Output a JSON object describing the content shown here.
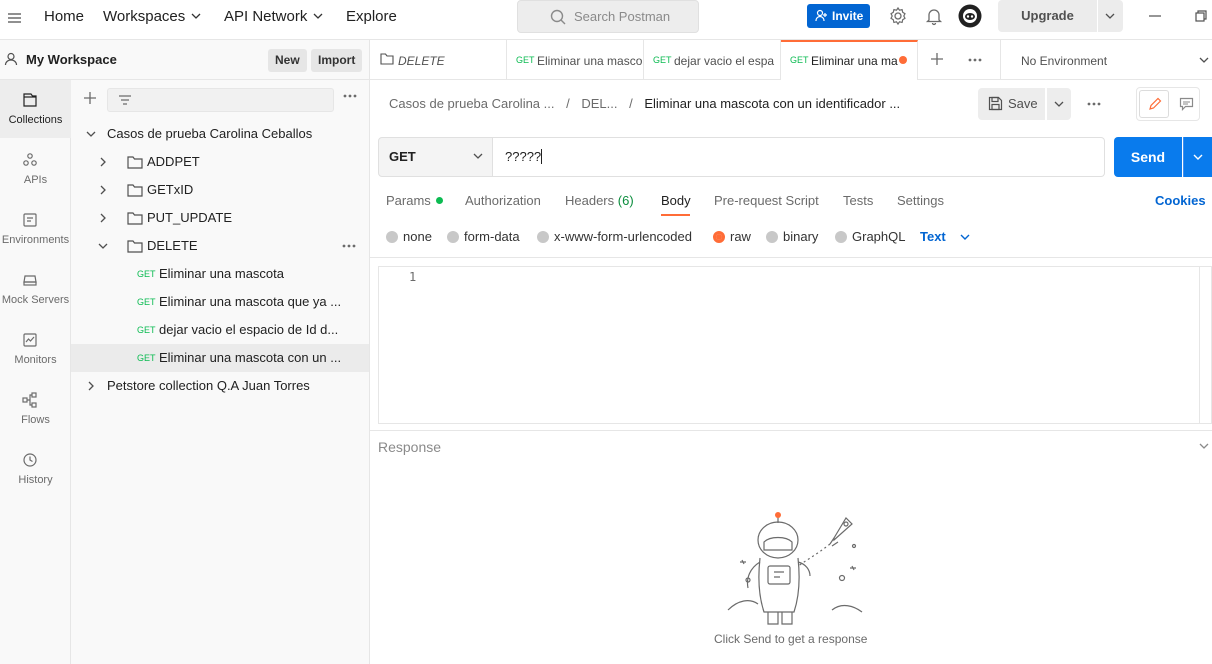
{
  "topbar": {
    "nav": [
      {
        "label": "Home",
        "has_chevron": false
      },
      {
        "label": "Workspaces",
        "has_chevron": true
      },
      {
        "label": "API Network",
        "has_chevron": true
      },
      {
        "label": "Explore",
        "has_chevron": false
      }
    ],
    "search_placeholder": "Search Postman",
    "invite_label": "Invite",
    "upgrade_label": "Upgrade",
    "icons": [
      "menu-icon",
      "search-icon",
      "settings-icon",
      "bell-icon",
      "avatar-icon",
      "minimize-icon",
      "restore-icon"
    ]
  },
  "workspace": {
    "title": "My Workspace",
    "new_label": "New",
    "import_label": "Import"
  },
  "rail": [
    {
      "label": "Collections",
      "icon": "collections-icon",
      "active": true
    },
    {
      "label": "APIs",
      "icon": "apis-icon",
      "active": false
    },
    {
      "label": "Environments",
      "icon": "environments-icon",
      "active": false
    },
    {
      "label": "Mock Servers",
      "icon": "mock-servers-icon",
      "active": false
    },
    {
      "label": "Monitors",
      "icon": "monitors-icon",
      "active": false
    },
    {
      "label": "Flows",
      "icon": "flows-icon",
      "active": false
    },
    {
      "label": "History",
      "icon": "history-icon",
      "active": false
    }
  ],
  "tree": [
    {
      "label": "Casos de prueba Carolina Ceballos",
      "type": "collection",
      "expanded": true
    },
    {
      "label": "ADDPET",
      "type": "folder",
      "expanded": false
    },
    {
      "label": "GETxID",
      "type": "folder",
      "expanded": false
    },
    {
      "label": "PUT_UPDATE",
      "type": "folder",
      "expanded": false
    },
    {
      "label": "DELETE",
      "type": "folder",
      "expanded": true
    },
    {
      "label": "Eliminar una mascota",
      "type": "request",
      "method": "GET"
    },
    {
      "label": "Eliminar una mascota que ya ...",
      "type": "request",
      "method": "GET"
    },
    {
      "label": "dejar vacio el espacio de Id d...",
      "type": "request",
      "method": "GET"
    },
    {
      "label": "Eliminar una mascota con un ...",
      "type": "request",
      "method": "GET",
      "selected": true
    },
    {
      "label": "Petstore collection Q.A Juan Torres",
      "type": "collection",
      "expanded": false
    }
  ],
  "tabs": [
    {
      "label": "DELETE",
      "method": "",
      "type": "folder"
    },
    {
      "label": "Eliminar una masco",
      "method": "GET"
    },
    {
      "label": "dejar vacio el espa",
      "method": "GET"
    },
    {
      "label": "Eliminar una ma",
      "method": "GET",
      "active": true,
      "unsaved": true
    }
  ],
  "environment": "No Environment",
  "breadcrumb": {
    "collection": "Casos de prueba Carolina ...",
    "folder": "DEL...",
    "request": "Eliminar una mascota con un identificador ...",
    "separator": "/"
  },
  "save_label": "Save",
  "request": {
    "method": "GET",
    "url": "?????",
    "send_label": "Send"
  },
  "request_tabs": [
    {
      "label": "Params",
      "dot": true
    },
    {
      "label": "Authorization"
    },
    {
      "label": "Headers",
      "count": "(6)"
    },
    {
      "label": "Body",
      "active": true
    },
    {
      "label": "Pre-request Script"
    },
    {
      "label": "Tests"
    },
    {
      "label": "Settings"
    }
  ],
  "cookies_label": "Cookies",
  "body_types": [
    {
      "label": "none",
      "checked": false
    },
    {
      "label": "form-data",
      "checked": false
    },
    {
      "label": "x-www-form-urlencoded",
      "checked": false
    },
    {
      "label": "raw",
      "checked": true
    },
    {
      "label": "binary",
      "checked": false
    },
    {
      "label": "GraphQL",
      "checked": false
    }
  ],
  "raw_type": "Text",
  "editor": {
    "line_number": "1"
  },
  "response": {
    "title": "Response",
    "hint": "Click Send to get a response"
  },
  "colors": {
    "accent": "#ff6c37",
    "primary": "#097bed",
    "invite": "#0265d2",
    "get_method": "#0cbb52"
  }
}
